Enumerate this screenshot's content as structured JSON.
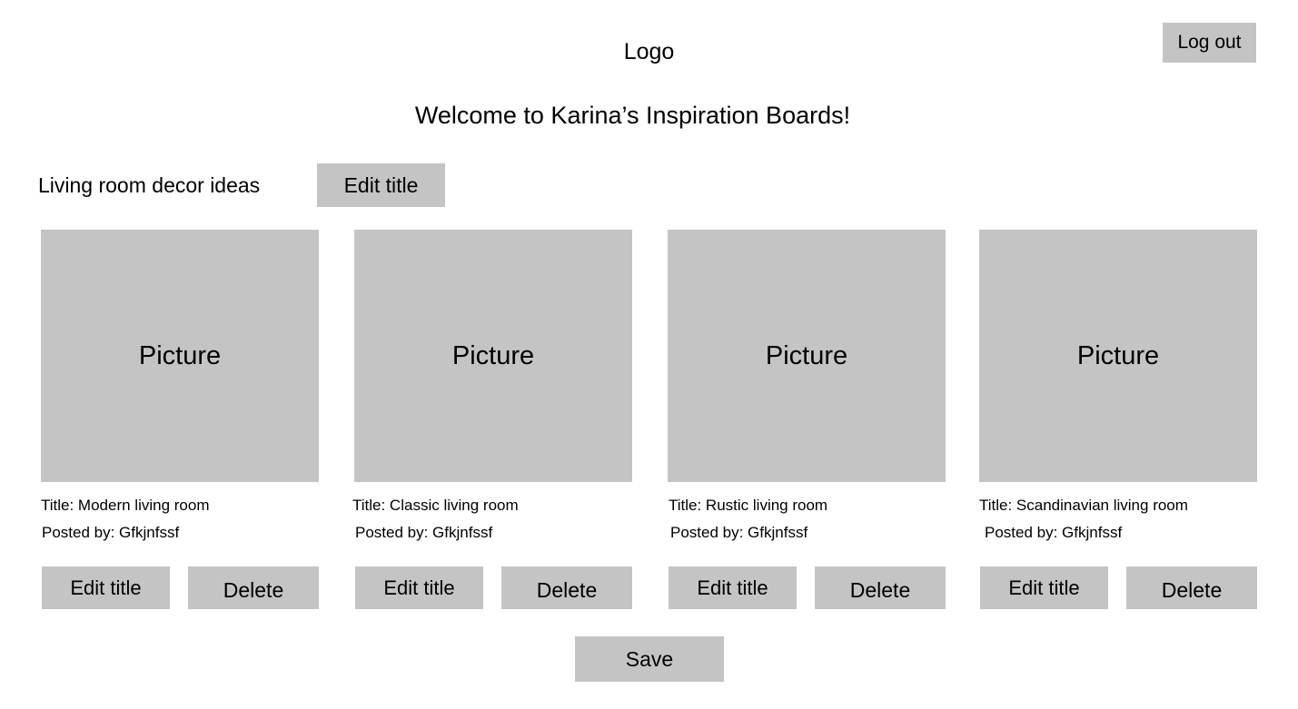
{
  "header": {
    "logo": "Logo",
    "logout_label": "Log out",
    "welcome": "Welcome to Karina’s Inspiration Boards!"
  },
  "board": {
    "title": "Living room decor ideas",
    "edit_title_label": "Edit title"
  },
  "cards": [
    {
      "picture_label": "Picture",
      "title": "Title: Modern living room",
      "posted_by": "Posted by: Gfkjnfssf",
      "edit_label": "Edit title",
      "delete_label": "Delete"
    },
    {
      "picture_label": "Picture",
      "title": "Title: Classic living room",
      "posted_by": "Posted by: Gfkjnfssf",
      "edit_label": "Edit title",
      "delete_label": "Delete"
    },
    {
      "picture_label": "Picture",
      "title": "Title: Rustic living room",
      "posted_by": "Posted by: Gfkjnfssf",
      "edit_label": "Edit title",
      "delete_label": "Delete"
    },
    {
      "picture_label": "Picture",
      "title": "Title: Scandinavian living room",
      "posted_by": "Posted by: Gfkjnfssf",
      "edit_label": "Edit title",
      "delete_label": "Delete"
    }
  ],
  "footer": {
    "save_label": "Save"
  },
  "colors": {
    "placeholder_gray": "#c4c4c4",
    "background": "#ffffff",
    "text": "#000000"
  }
}
